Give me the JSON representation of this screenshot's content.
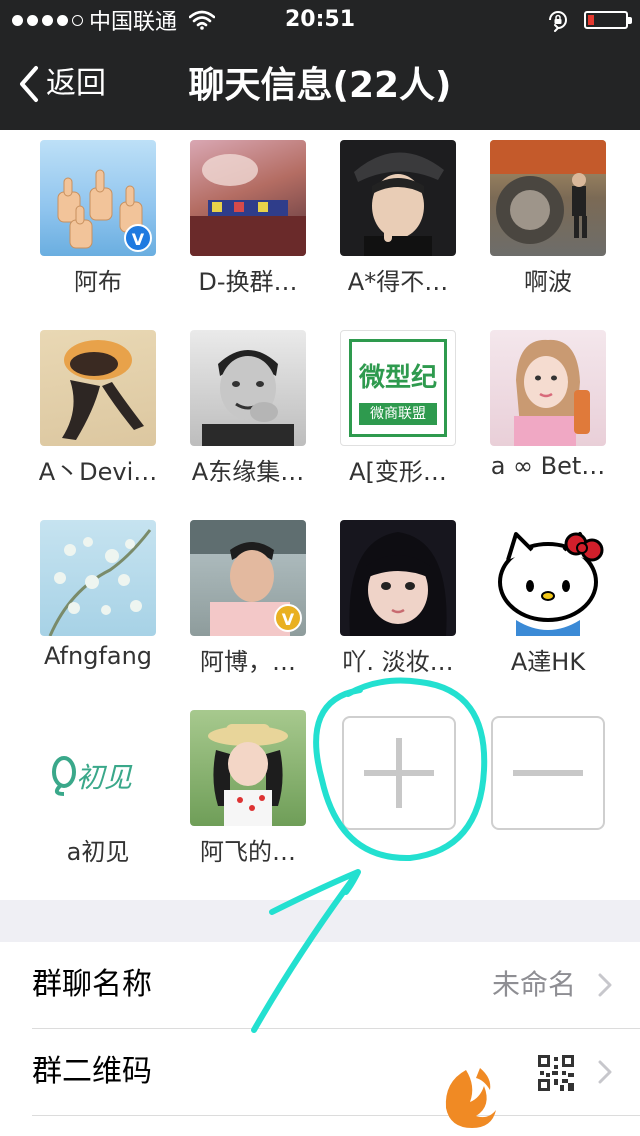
{
  "status": {
    "carrier": "中国联通",
    "time": "20:51",
    "signal_icon": "signal-dots-icon",
    "wifi_icon": "wifi-icon",
    "rotation_lock_icon": "rotation-lock-icon",
    "battery_icon": "battery-low-icon",
    "battery_color": "#e53a30"
  },
  "nav": {
    "back_label": "返回",
    "title": "聊天信息(22人)",
    "background": "#232425"
  },
  "members": [
    {
      "name": "阿布",
      "badge": "V",
      "badge_color": "#1f7ae0"
    },
    {
      "name": "D-换群…",
      "badge": "",
      "badge_color": ""
    },
    {
      "name": "A*得不…",
      "badge": "",
      "badge_color": ""
    },
    {
      "name": "啊波",
      "badge": "",
      "badge_color": ""
    },
    {
      "name": "A丶Devi…",
      "badge": "",
      "badge_color": ""
    },
    {
      "name": "A东缘集…",
      "badge": "",
      "badge_color": ""
    },
    {
      "name": "A[变形…",
      "badge": "",
      "badge_color": ""
    },
    {
      "name": "a ∞ Bet…",
      "badge": "",
      "badge_color": ""
    },
    {
      "name": "Afngfang",
      "badge": "",
      "badge_color": ""
    },
    {
      "name": "阿博，…",
      "badge": "V",
      "badge_color": "#e9b021"
    },
    {
      "name": "吖. 淡妆…",
      "badge": "",
      "badge_color": ""
    },
    {
      "name": "A達HK",
      "badge": "",
      "badge_color": ""
    },
    {
      "name": "a初见",
      "badge": "",
      "badge_color": ""
    },
    {
      "name": "阿飞的…",
      "badge": "",
      "badge_color": ""
    }
  ],
  "avatar_logos": {
    "weixing": "微型纪",
    "weishang": "微商联盟",
    "chujian": "初见"
  },
  "actions": {
    "add_icon": "plus-icon",
    "remove_icon": "minus-icon"
  },
  "settings": {
    "group_name_label": "群聊名称",
    "group_name_value": "未命名",
    "qr_label": "群二维码",
    "qr_icon": "qr-code-icon",
    "chevron_icon": "chevron-right-icon"
  },
  "annotation": {
    "color": "#23e0d0",
    "circle_icon": "hand-drawn-circle",
    "arrow_icon": "hand-drawn-arrow"
  },
  "watermark_icon": "fox-logo-icon"
}
